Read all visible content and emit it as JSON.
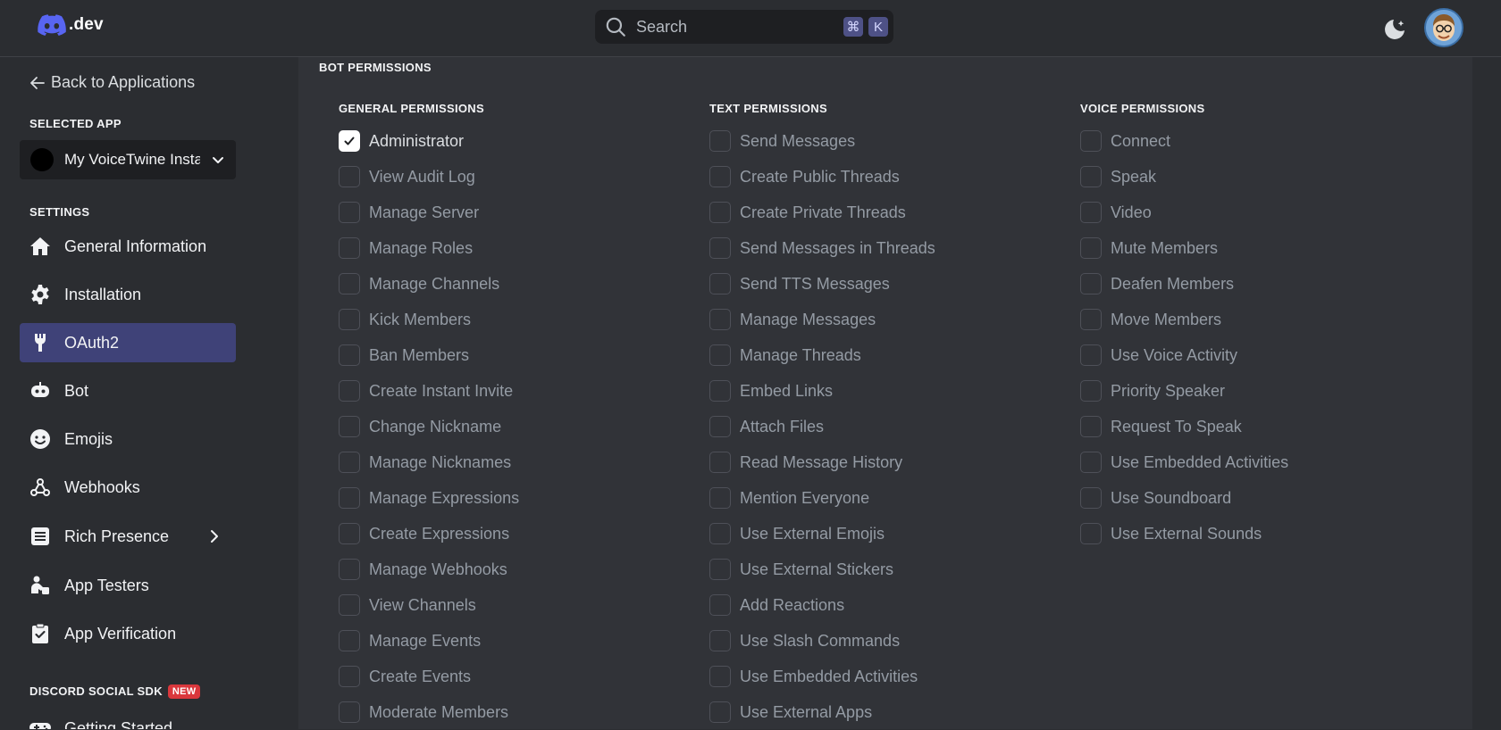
{
  "topbar": {
    "logo_text": ".dev",
    "search_placeholder": "Search",
    "shortcut_keys": [
      "⌘",
      "K"
    ],
    "icons": [
      "discord-logo-icon",
      "search-icon",
      "theme-toggle-icon",
      "avatar"
    ]
  },
  "sidebar": {
    "back_label": "Back to Applications",
    "selected_app_title": "SELECTED APP",
    "selected_app_name": "My VoiceTwine Insta",
    "settings_title": "SETTINGS",
    "items": [
      {
        "label": "General Information",
        "icon": "home-icon"
      },
      {
        "label": "Installation",
        "icon": "gear-icon"
      },
      {
        "label": "OAuth2",
        "icon": "wrench-icon",
        "active": true
      },
      {
        "label": "Bot",
        "icon": "bot-icon"
      },
      {
        "label": "Emojis",
        "icon": "emoji-icon"
      },
      {
        "label": "Webhooks",
        "icon": "webhook-icon"
      },
      {
        "label": "Rich Presence",
        "icon": "rich-presence-icon"
      },
      {
        "label": "App Testers",
        "icon": "app-testers-icon"
      },
      {
        "label": "App Verification",
        "icon": "verification-icon"
      }
    ],
    "sdk_title": "DISCORD SOCIAL SDK",
    "sdk_badge": "NEW",
    "sdk_items": [
      {
        "label": "Getting Started",
        "icon": "gamepad-icon"
      }
    ]
  },
  "main": {
    "title": "BOT PERMISSIONS",
    "general": {
      "title": "GENERAL PERMISSIONS",
      "items": [
        {
          "label": "Administrator",
          "checked": true
        },
        {
          "label": "View Audit Log",
          "checked": false
        },
        {
          "label": "Manage Server",
          "checked": false
        },
        {
          "label": "Manage Roles",
          "checked": false
        },
        {
          "label": "Manage Channels",
          "checked": false
        },
        {
          "label": "Kick Members",
          "checked": false
        },
        {
          "label": "Ban Members",
          "checked": false
        },
        {
          "label": "Create Instant Invite",
          "checked": false
        },
        {
          "label": "Change Nickname",
          "checked": false
        },
        {
          "label": "Manage Nicknames",
          "checked": false
        },
        {
          "label": "Manage Expressions",
          "checked": false
        },
        {
          "label": "Create Expressions",
          "checked": false
        },
        {
          "label": "Manage Webhooks",
          "checked": false
        },
        {
          "label": "View Channels",
          "checked": false
        },
        {
          "label": "Manage Events",
          "checked": false
        },
        {
          "label": "Create Events",
          "checked": false
        },
        {
          "label": "Moderate Members",
          "checked": false
        }
      ]
    },
    "text": {
      "title": "TEXT PERMISSIONS",
      "items": [
        {
          "label": "Send Messages",
          "checked": false
        },
        {
          "label": "Create Public Threads",
          "checked": false
        },
        {
          "label": "Create Private Threads",
          "checked": false
        },
        {
          "label": "Send Messages in Threads",
          "checked": false
        },
        {
          "label": "Send TTS Messages",
          "checked": false
        },
        {
          "label": "Manage Messages",
          "checked": false
        },
        {
          "label": "Manage Threads",
          "checked": false
        },
        {
          "label": "Embed Links",
          "checked": false
        },
        {
          "label": "Attach Files",
          "checked": false
        },
        {
          "label": "Read Message History",
          "checked": false
        },
        {
          "label": "Mention Everyone",
          "checked": false
        },
        {
          "label": "Use External Emojis",
          "checked": false
        },
        {
          "label": "Use External Stickers",
          "checked": false
        },
        {
          "label": "Add Reactions",
          "checked": false
        },
        {
          "label": "Use Slash Commands",
          "checked": false
        },
        {
          "label": "Use Embedded Activities",
          "checked": false
        },
        {
          "label": "Use External Apps",
          "checked": false
        }
      ]
    },
    "voice": {
      "title": "VOICE PERMISSIONS",
      "items": [
        {
          "label": "Connect",
          "checked": false
        },
        {
          "label": "Speak",
          "checked": false
        },
        {
          "label": "Video",
          "checked": false
        },
        {
          "label": "Mute Members",
          "checked": false
        },
        {
          "label": "Deafen Members",
          "checked": false
        },
        {
          "label": "Move Members",
          "checked": false
        },
        {
          "label": "Use Voice Activity",
          "checked": false
        },
        {
          "label": "Priority Speaker",
          "checked": false
        },
        {
          "label": "Request To Speak",
          "checked": false
        },
        {
          "label": "Use Embedded Activities",
          "checked": false
        },
        {
          "label": "Use Soundboard",
          "checked": false
        },
        {
          "label": "Use External Sounds",
          "checked": false
        }
      ]
    }
  },
  "colors": {
    "background": "#2b2d31",
    "content": "#313338",
    "accent": "#5865f2",
    "active_nav": "#3f4278",
    "badge": "#da373c"
  }
}
